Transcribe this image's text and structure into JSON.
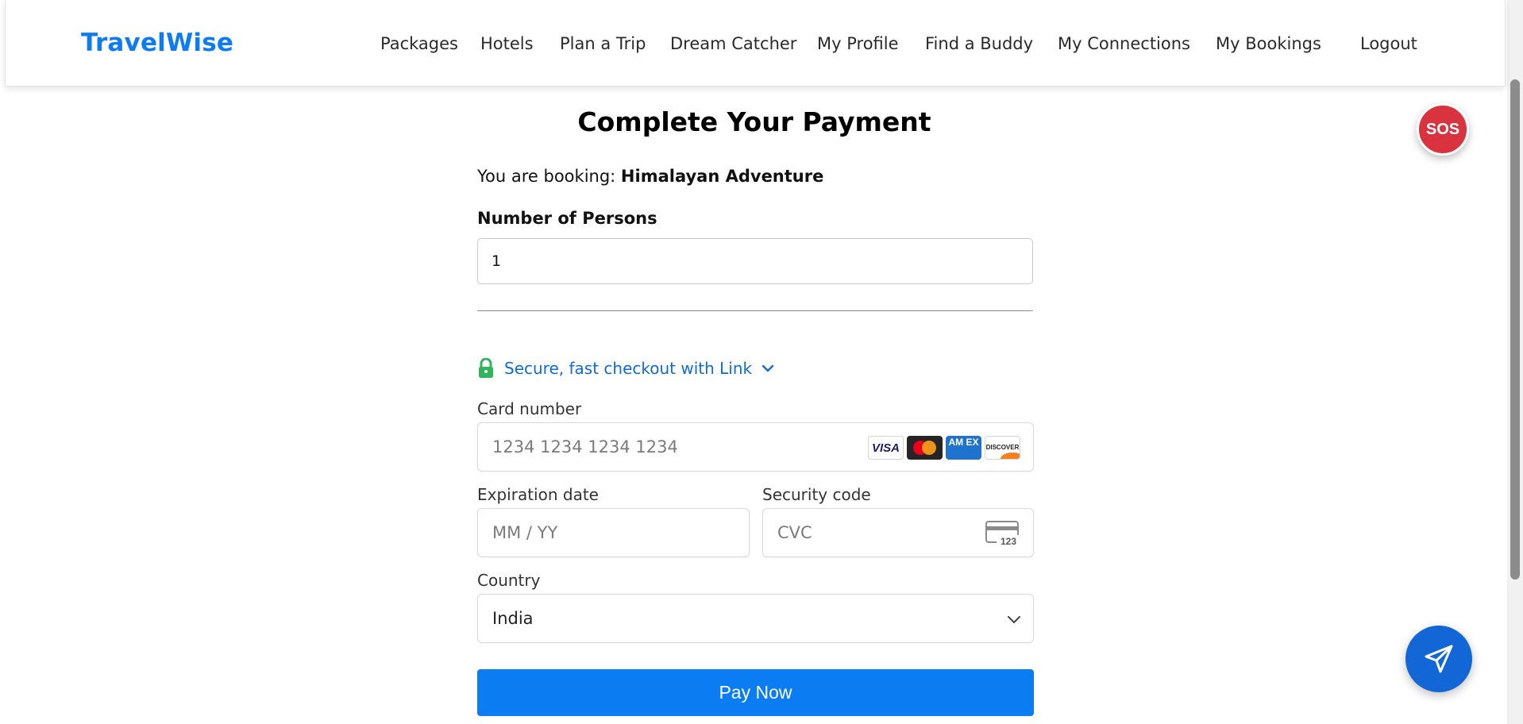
{
  "nav": {
    "brand": "TravelWise",
    "links": [
      "Packages",
      "Hotels",
      "Plan a Trip",
      "Dream Catcher",
      "My Profile",
      "Find a Buddy",
      "My Connections",
      "My Bookings",
      "Logout"
    ]
  },
  "payment": {
    "title": "Complete Your Payment",
    "booking_prefix": "You are booking: ",
    "package_name": "Himalayan Adventure",
    "persons_label": "Number of Persons",
    "persons_value": "1",
    "link_text": "Secure, fast checkout with Link",
    "card_number_label": "Card number",
    "card_number_placeholder": "1234 1234 1234 1234",
    "card_brands": {
      "visa": "VISA",
      "amex": "AM EX",
      "discover": "DISCOVER"
    },
    "expiration_label": "Expiration date",
    "expiration_placeholder": "MM / YY",
    "security_label": "Security code",
    "security_placeholder": "CVC",
    "cvc_icon_text": "123",
    "country_label": "Country",
    "country_value": "India",
    "pay_button": "Pay Now"
  },
  "floating": {
    "sos_label": "SOS",
    "send_icon": "paper-plane-icon"
  },
  "colors": {
    "brand": "#0d7cf2",
    "link": "#0f6bd8",
    "lock": "#30b55a",
    "pay_button": "#0b7cf2",
    "sos": "#d9333f",
    "send": "#1266d6"
  }
}
